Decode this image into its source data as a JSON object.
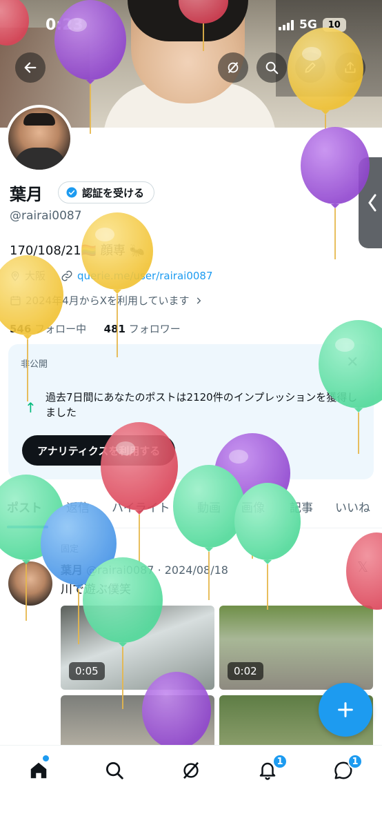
{
  "status_bar": {
    "time": "0:23",
    "network": "5G",
    "battery": "10"
  },
  "profile": {
    "name": "葉月",
    "verify_label": "認証を受ける",
    "handle": "@rairai0087",
    "bio": "170/108/21🏳️‍🌈 顔専 🐜",
    "location": "大阪",
    "link": "querie.me/user/rairai0087",
    "joined": "2024年4月からXを利用しています",
    "following_count": "546",
    "following_label": "フォロー中",
    "followers_count": "481",
    "followers_label": "フォロワー"
  },
  "analytics_card": {
    "tag": "非公開",
    "message": "過去7日間にあなたのポストは2120件のインプレッションを獲得しました",
    "button": "アナリティクスを利用する"
  },
  "tabs": [
    "ポスト",
    "返信",
    "ハイライト",
    "動画",
    "画像",
    "記事",
    "いいね"
  ],
  "post": {
    "pinned_label": "固定",
    "author": "葉月",
    "handle_date": "@rairai0087 · 2024/08/18",
    "text": "川で遊ぶ僕笑",
    "durations": [
      "0:05",
      "0:02"
    ]
  },
  "nav": {
    "notifications_badge": "1",
    "messages_badge": "1"
  },
  "icons": [
    "back-arrow-icon",
    "grok-icon",
    "search-icon",
    "edit-icon",
    "share-icon",
    "verified-icon",
    "location-icon",
    "link-icon",
    "calendar-icon",
    "chevron-right-icon",
    "close-icon",
    "up-arrow-icon",
    "x-logo-icon",
    "plus-icon",
    "home-icon",
    "bell-icon",
    "messages-icon"
  ],
  "colors": {
    "accent": "#1d9bf0",
    "balloon_yellow": "#f4c842",
    "balloon_purple": "#a35fd8",
    "balloon_green": "#6fe3ad",
    "balloon_red": "#e05565",
    "balloon_blue": "#5aa6ee"
  }
}
